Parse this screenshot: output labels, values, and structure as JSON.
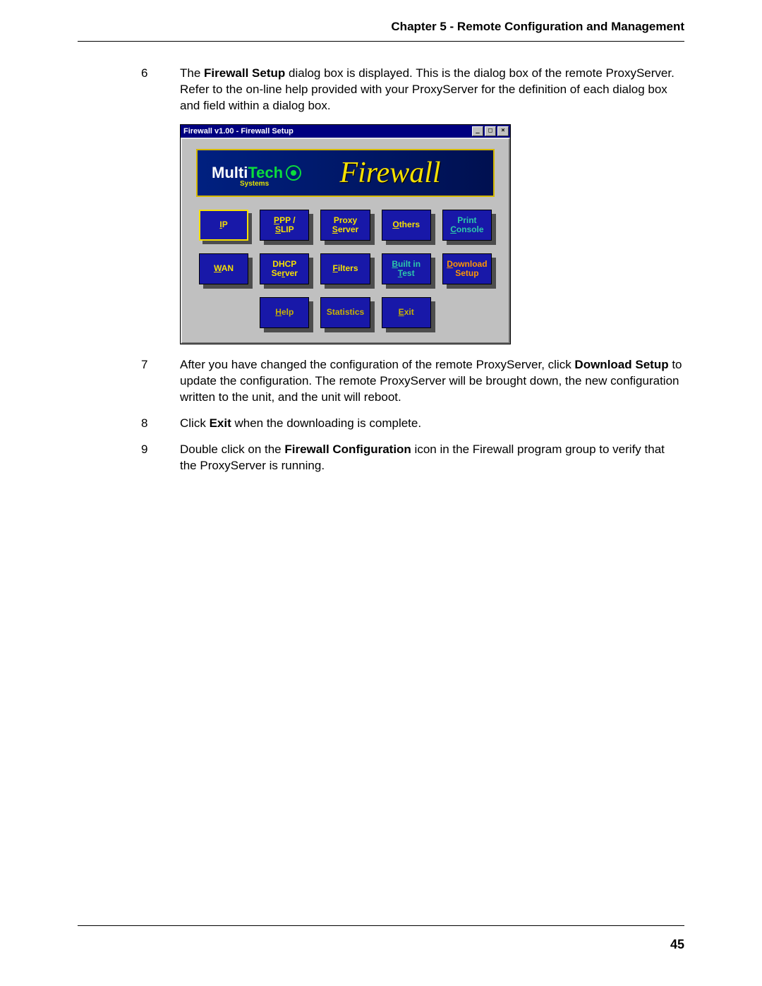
{
  "header": "Chapter 5 - Remote Configuration and Management",
  "page_number": "45",
  "steps": [
    {
      "num": "6",
      "html": "The <b>Firewall Setup</b> dialog box is displayed. This is the dialog box of the remote ProxyServer. Refer to the on-line help provided with your ProxyServer for the definition of each dialog box and field within a dialog box."
    },
    {
      "num": "7",
      "html": "After you have changed the configuration of the remote ProxyServer, click <b>Download Setup</b> to update the configuration. The remote ProxyServer will be brought down, the new configuration written to the unit, and the unit will reboot."
    },
    {
      "num": "8",
      "html": "Click <b>Exit</b> when the downloading is complete."
    },
    {
      "num": "9",
      "html": "Double click on the <b>Firewall Configuration</b> icon in the Firewall program group to verify that the ProxyServer is running."
    }
  ],
  "dialog": {
    "title": "Firewall v1.00 - Firewall Setup",
    "banner": {
      "multi": "Multi",
      "tech": "Tech",
      "systems": "Systems",
      "title": "Firewall"
    },
    "buttons": {
      "r1": [
        {
          "id": "ip",
          "style": "yellow-border",
          "line1_u": "I",
          "line1_rest": "P"
        },
        {
          "id": "ppp",
          "style": "",
          "line1_u": "P",
          "line1_rest": "PP /",
          "line2_u": "",
          "line2_rest": "SLIP"
        },
        {
          "id": "proxy",
          "style": "",
          "line1_u": "",
          "line1_rest": "Proxy",
          "line2_u": "S",
          "line2_rest": "erver"
        },
        {
          "id": "others",
          "style": "",
          "line1_u": "O",
          "line1_rest": "thers"
        },
        {
          "id": "print",
          "style": "teal",
          "line1_u": "",
          "line1_rest": "Print",
          "line2_u": "C",
          "line2_rest": "onsole"
        }
      ],
      "r2": [
        {
          "id": "wan",
          "style": "",
          "line1_u": "W",
          "line1_rest": "AN"
        },
        {
          "id": "dhcp",
          "style": "",
          "line1_u": "",
          "line1_rest": "DHCP",
          "line2_u": "",
          "line2_rest": "Server",
          "line2_full_u": "r"
        },
        {
          "id": "filters",
          "style": "",
          "line1_u": "F",
          "line1_rest": "ilters"
        },
        {
          "id": "builtin",
          "style": "teal",
          "line1_u": "B",
          "line1_rest": "uilt in",
          "line2_u": "T",
          "line2_rest": "est"
        },
        {
          "id": "download",
          "style": "orange",
          "line1_u": "D",
          "line1_rest": "ownload",
          "line2_u": "",
          "line2_rest": "Setup"
        }
      ],
      "r3": [
        {
          "id": "help",
          "style": "darker",
          "line1_u": "H",
          "line1_rest": "elp"
        },
        {
          "id": "stats",
          "style": "darker",
          "line1_u": "",
          "line1_rest": "Statistics"
        },
        {
          "id": "exit",
          "style": "darker",
          "line1_u": "E",
          "line1_rest": "xit"
        }
      ]
    }
  }
}
